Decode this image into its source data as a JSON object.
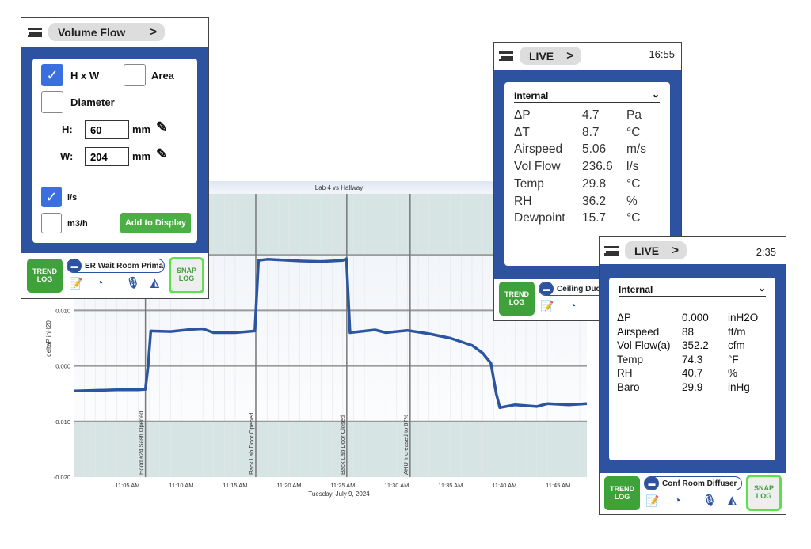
{
  "chart_data": {
    "type": "line",
    "title": "Lab 4 vs Hallway",
    "xlabel": "Tuesday, July 9, 2024",
    "ylabel": "deltaP inH20",
    "ylim": [
      -0.02,
      0.031
    ],
    "xlim": [
      "11:00:00",
      "11:47:40"
    ],
    "yticks": [
      "-0.020",
      "-0.010",
      "0.000",
      "0.010"
    ],
    "ytick_values": [
      -0.02,
      -0.01,
      0,
      0.01
    ],
    "xticks": [
      "11:05 AM",
      "11:10 AM",
      "11:15 AM",
      "11:20 AM",
      "11:25 AM",
      "11:30 AM",
      "11:35 AM",
      "11:40 AM",
      "11:45 AM"
    ],
    "xtick_times": [
      "11:05:00",
      "11:10:00",
      "11:15:00",
      "11:20:00",
      "11:25:00",
      "11:30:00",
      "11:35:00",
      "11:40:00",
      "11:45:00"
    ],
    "shaded_bands": [
      [
        0.02,
        0.031
      ],
      [
        -0.02,
        -0.01
      ]
    ],
    "grid": true,
    "series_color": "#2b55a0",
    "band_color": "#d7e4e4",
    "series": [
      {
        "x": [
          "11:00:00",
          "11:02:00",
          "11:04:00",
          "11:06:00",
          "11:06:40",
          "11:06:55",
          "11:07:10",
          "11:09:00",
          "11:11:00",
          "11:12:00",
          "11:13:00",
          "11:15:00",
          "11:16:50",
          "11:17:10",
          "11:18:00",
          "11:21:00",
          "11:23:00",
          "11:25:00",
          "11:25:20",
          "11:25:40",
          "11:28:00",
          "11:29:00",
          "11:31:00",
          "11:33:00",
          "11:35:00",
          "11:37:00",
          "11:38:00",
          "11:38:45",
          "11:39:15",
          "11:39:35",
          "11:41:00",
          "11:43:00",
          "11:44:00",
          "11:46:00",
          "11:47:40"
        ],
        "y": [
          -0.0045,
          -0.0044,
          -0.0043,
          -0.0043,
          -0.0042,
          0.0,
          0.0063,
          0.0062,
          0.0066,
          0.0067,
          0.006,
          0.006,
          0.0063,
          0.019,
          0.0192,
          0.0189,
          0.0188,
          0.019,
          0.0193,
          0.006,
          0.0065,
          0.006,
          0.0064,
          0.0058,
          0.005,
          0.0037,
          0.0023,
          0.0005,
          -0.005,
          -0.0075,
          -0.007,
          -0.0073,
          -0.0068,
          -0.007,
          -0.0068
        ]
      }
    ],
    "annotations": [
      {
        "time": "11:06:40",
        "text": "Hood #24 Sash Opened"
      },
      {
        "time": "11:16:55",
        "text": "Back Lab Door Opened"
      },
      {
        "time": "11:25:22",
        "text": "Back Lab Door Closed"
      },
      {
        "time": "11:31:15",
        "text": "AHU Increased to 67%"
      }
    ]
  },
  "volume_panel": {
    "menu": "Volume Flow",
    "hxw": "H x W",
    "hxw_checked": true,
    "area": "Area",
    "area_checked": false,
    "diameter": "Diameter",
    "diameter_checked": false,
    "h_label": "H:",
    "h_value": "60",
    "h_unit": "mm",
    "w_label": "W:",
    "w_value": "204",
    "w_unit": "mm",
    "ls": "l/s",
    "ls_checked": true,
    "m3h": "m3/h",
    "m3h_checked": false,
    "add": "Add to Display",
    "trend": "TREND LOG",
    "snap": "SNAP LOG",
    "location": "ER Wait Room Primary"
  },
  "live_panel_1": {
    "menu": "LIVE",
    "time": "16:55",
    "section": "Internal",
    "rows": [
      [
        "ΔP",
        "4.7",
        "Pa"
      ],
      [
        "ΔT",
        "8.7",
        "°C"
      ],
      [
        "Airspeed",
        "5.06",
        "m/s"
      ],
      [
        "Vol Flow",
        "236.6",
        "l/s"
      ],
      [
        "Temp",
        "29.8",
        "°C"
      ],
      [
        "RH",
        "36.2",
        "%"
      ],
      [
        "Dewpoint",
        "15.7",
        "°C"
      ]
    ],
    "trend": "TREND LOG",
    "location": "Ceiling Duct"
  },
  "live_panel_2": {
    "menu": "LIVE",
    "time": "2:35",
    "section": "Internal",
    "rows": [
      [
        "ΔP",
        "0.000",
        "inH2O"
      ],
      [
        "Airspeed",
        "88",
        "ft/m"
      ],
      [
        "Vol Flow(a)",
        "352.2",
        "cfm"
      ],
      [
        "Temp",
        "74.3",
        "°F"
      ],
      [
        "RH",
        "40.7",
        "%"
      ],
      [
        "Baro",
        "29.9",
        "inHg"
      ]
    ],
    "trend": "TREND LOG",
    "snap": "SNAP LOG",
    "location": "Conf Room Diffuser"
  }
}
